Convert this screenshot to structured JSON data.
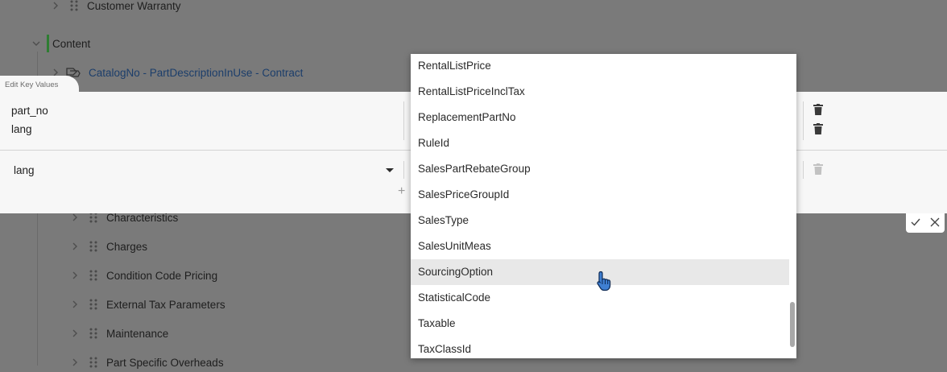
{
  "tree": {
    "customer_warranty": "Customer Warranty",
    "content": "Content",
    "catalog_link": "CatalogNo - PartDescriptionInUse - Contract",
    "children": [
      "Characteristics",
      "Charges",
      "Condition Code Pricing",
      "External Tax Parameters",
      "Maintenance",
      "Part Specific Overheads"
    ]
  },
  "dialog": {
    "title": "Edit Key Values",
    "keys": [
      "part_no",
      "lang"
    ],
    "select_value": "lang",
    "add_symbol": "+"
  },
  "dropdown": {
    "options": [
      "RentalListPrice",
      "RentalListPriceInclTax",
      "ReplacementPartNo",
      "RuleId",
      "SalesPartRebateGroup",
      "SalesPriceGroupId",
      "SalesType",
      "SalesUnitMeas",
      "SourcingOption",
      "StatisticalCode",
      "Taxable",
      "TaxClassId"
    ],
    "hovered": "SourcingOption"
  },
  "colors": {
    "overlay": "#7a7a7a",
    "dialog_bg": "#f7f7f7",
    "content_marker": "#2e7d32",
    "link": "#1c3e6b",
    "hover_bg": "#e8e8e8"
  },
  "icons": [
    "chevron-right-icon",
    "chevron-down-icon",
    "drag-handle-icon",
    "catalog-icon",
    "trash-icon",
    "check-icon",
    "close-icon",
    "pointer-cursor-icon"
  ]
}
